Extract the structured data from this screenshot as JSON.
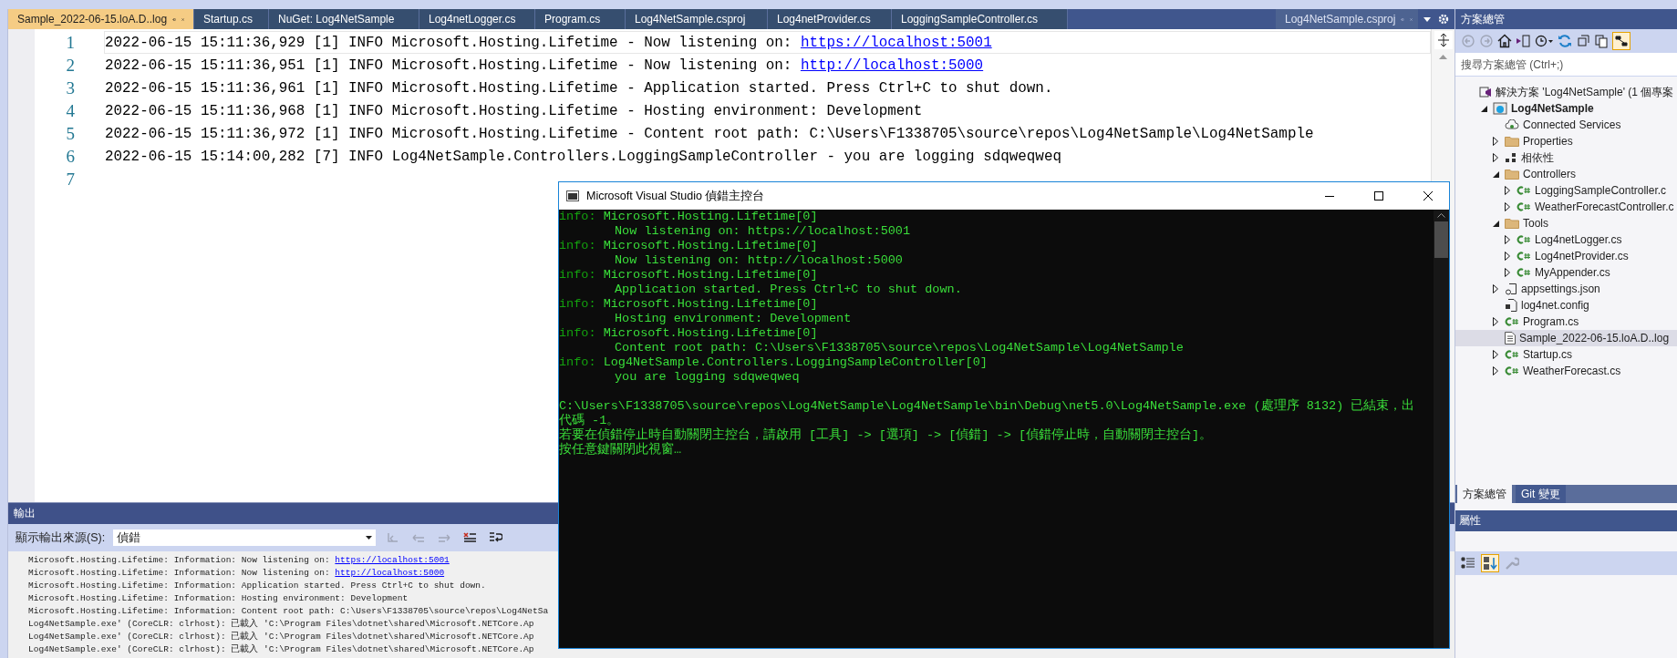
{
  "tabs": [
    {
      "label": "Sample_2022-06-15.loA.D..log",
      "selected": true
    },
    {
      "label": "Startup.cs",
      "selected": false
    },
    {
      "label": "NuGet: Log4NetSample",
      "selected": false
    },
    {
      "label": "Log4netLogger.cs",
      "selected": false
    },
    {
      "label": "Program.cs",
      "selected": false
    },
    {
      "label": "Log4NetSample.csproj",
      "selected": false
    },
    {
      "label": "Log4netProvider.cs",
      "selected": false
    },
    {
      "label": "LoggingSampleController.cs",
      "selected": false
    }
  ],
  "side_tab": {
    "label": "Log4NetSample.csproj"
  },
  "editor": {
    "lines": [
      {
        "number": "1",
        "current": true,
        "text": "2022-06-15 15:11:36,929 [1] INFO Microsoft.Hosting.Lifetime - Now listening on: ",
        "link": "https://localhost:5001"
      },
      {
        "number": "2",
        "current": false,
        "text": "2022-06-15 15:11:36,951 [1] INFO Microsoft.Hosting.Lifetime - Now listening on: ",
        "link": "http://localhost:5000"
      },
      {
        "number": "3",
        "current": false,
        "text": "2022-06-15 15:11:36,961 [1] INFO Microsoft.Hosting.Lifetime - Application started. Press Ctrl+C to shut down."
      },
      {
        "number": "4",
        "current": false,
        "text": "2022-06-15 15:11:36,968 [1] INFO Microsoft.Hosting.Lifetime - Hosting environment: Development"
      },
      {
        "number": "5",
        "current": false,
        "text": "2022-06-15 15:11:36,972 [1] INFO Microsoft.Hosting.Lifetime - Content root path: C:\\Users\\F1338705\\source\\repos\\Log4NetSample\\Log4NetSample"
      },
      {
        "number": "6",
        "current": false,
        "text": "2022-06-15 15:14:00,282 [7] INFO Log4NetSample.Controllers.LoggingSampleController - you are logging sdqweqweq"
      },
      {
        "number": "7",
        "current": false
      }
    ]
  },
  "output": {
    "title": "輸出",
    "source_label": "顯示輸出來源(S):",
    "source_value": "偵錯",
    "toolbar_buttons": [
      {
        "kind": "goto",
        "disabled": true
      },
      {
        "kind": "previous",
        "disabled": true
      },
      {
        "kind": "next",
        "disabled": true
      },
      {
        "kind": "clear",
        "disabled": false
      },
      {
        "kind": "wrap",
        "disabled": false
      }
    ],
    "lines": [
      {
        "text": "Microsoft.Hosting.Lifetime: Information: Now listening on: ",
        "link": "https://localhost:5001"
      },
      {
        "text": "Microsoft.Hosting.Lifetime: Information: Now listening on: ",
        "link": "http://localhost:5000"
      },
      {
        "text": "Microsoft.Hosting.Lifetime: Information: Application started. Press Ctrl+C to shut down."
      },
      {
        "text": "Microsoft.Hosting.Lifetime: Information: Hosting environment: Development"
      },
      {
        "text": "Microsoft.Hosting.Lifetime: Information: Content root path: C:\\Users\\F1338705\\source\\repos\\Log4NetSa"
      },
      {
        "text": "Log4NetSample.exe' (CoreCLR: clrhost): 已載入 'C:\\Program Files\\dotnet\\shared\\Microsoft.NETCore.Ap"
      },
      {
        "text": "Log4NetSample.exe' (CoreCLR: clrhost): 已載入 'C:\\Program Files\\dotnet\\shared\\Microsoft.NETCore.Ap"
      },
      {
        "text": "Log4NetSample.exe' (CoreCLR: clrhost): 已載入 'C:\\Program Files\\dotnet\\shared\\Microsoft.NETCore.Ap"
      }
    ]
  },
  "console": {
    "title": "Microsoft Visual Studio 偵錯主控台",
    "entries": [
      {
        "prefix": "info:",
        "category": "Microsoft.Hosting.Lifetime[0]",
        "message": "Now listening on: https://localhost:5001"
      },
      {
        "prefix": "info:",
        "category": "Microsoft.Hosting.Lifetime[0]",
        "message": "Now listening on: http://localhost:5000"
      },
      {
        "prefix": "info:",
        "category": "Microsoft.Hosting.Lifetime[0]",
        "message": "Application started. Press Ctrl+C to shut down."
      },
      {
        "prefix": "info:",
        "category": "Microsoft.Hosting.Lifetime[0]",
        "message": "Hosting environment: Development"
      },
      {
        "prefix": "info:",
        "category": "Microsoft.Hosting.Lifetime[0]",
        "message": "Content root path: C:\\Users\\F1338705\\source\\repos\\Log4NetSample\\Log4NetSample"
      },
      {
        "prefix": "info:",
        "category": "Log4NetSample.Controllers.LoggingSampleController[0]",
        "message": "you are logging sdqweqweq"
      }
    ],
    "footer_lines": [
      "C:\\Users\\F1338705\\source\\repos\\Log4NetSample\\Log4NetSample\\bin\\Debug\\net5.0\\Log4NetSample.exe (處理序 8132) 已結束，出",
      "代碼 -1。",
      "若要在偵錯停止時自動關閉主控台，請啟用 [工具] -> [選項] -> [偵錯] -> [偵錯停止時，自動關閉主控台]。",
      "按任意鍵關閉此視窗…"
    ]
  },
  "solution_explorer": {
    "title": "方案總管",
    "search": {
      "placeholder": "搜尋方案總管 (Ctrl+;)"
    },
    "sync_toggle": {
      "on": true
    },
    "tree": [
      {
        "label": "解決方案 'Log4NetSample' (1 個專案",
        "kind": "solution",
        "selected": false,
        "children": [
          {
            "label": "Log4NetSample",
            "kind": "project",
            "expanded": true,
            "selected": false,
            "children": [
              {
                "label": "Connected Services",
                "kind": "service",
                "selected": false
              },
              {
                "label": "Properties",
                "kind": "folder",
                "expanded": false,
                "selected": false
              },
              {
                "label": "相依性",
                "kind": "dependencies",
                "expanded": false,
                "selected": false
              },
              {
                "label": "Controllers",
                "kind": "folder",
                "expanded": true,
                "selected": false,
                "children": [
                  {
                    "label": "LoggingSampleController.c",
                    "kind": "code",
                    "expanded": false,
                    "selected": false
                  },
                  {
                    "label": "WeatherForecastController.c",
                    "kind": "code",
                    "expanded": false,
                    "selected": false
                  }
                ]
              },
              {
                "label": "Tools",
                "kind": "folder",
                "expanded": true,
                "selected": false,
                "children": [
                  {
                    "label": "Log4netLogger.cs",
                    "kind": "code",
                    "expanded": false,
                    "selected": false
                  },
                  {
                    "label": "Log4netProvider.cs",
                    "kind": "code",
                    "expanded": false,
                    "selected": false
                  },
                  {
                    "label": "MyAppender.cs",
                    "kind": "code",
                    "expanded": false,
                    "selected": false
                  }
                ]
              },
              {
                "label": "appsettings.json",
                "kind": "settings",
                "expanded": false,
                "selected": false
              },
              {
                "label": "log4net.config",
                "kind": "config",
                "selected": false
              },
              {
                "label": "Program.cs",
                "kind": "code",
                "expanded": false,
                "selected": false
              },
              {
                "label": "Sample_2022-06-15.loA.D..log",
                "kind": "text",
                "selected": true
              },
              {
                "label": "Startup.cs",
                "kind": "code",
                "expanded": false,
                "selected": false
              },
              {
                "label": "WeatherForecast.cs",
                "kind": "code",
                "expanded": false,
                "selected": false
              }
            ]
          }
        ]
      }
    ],
    "bottom_tabs": [
      {
        "label": "方案總管",
        "selected": true
      },
      {
        "label": "Git 變更",
        "selected": false
      }
    ]
  },
  "properties": {
    "title": "屬性",
    "alphabetical": {
      "on": true
    }
  }
}
